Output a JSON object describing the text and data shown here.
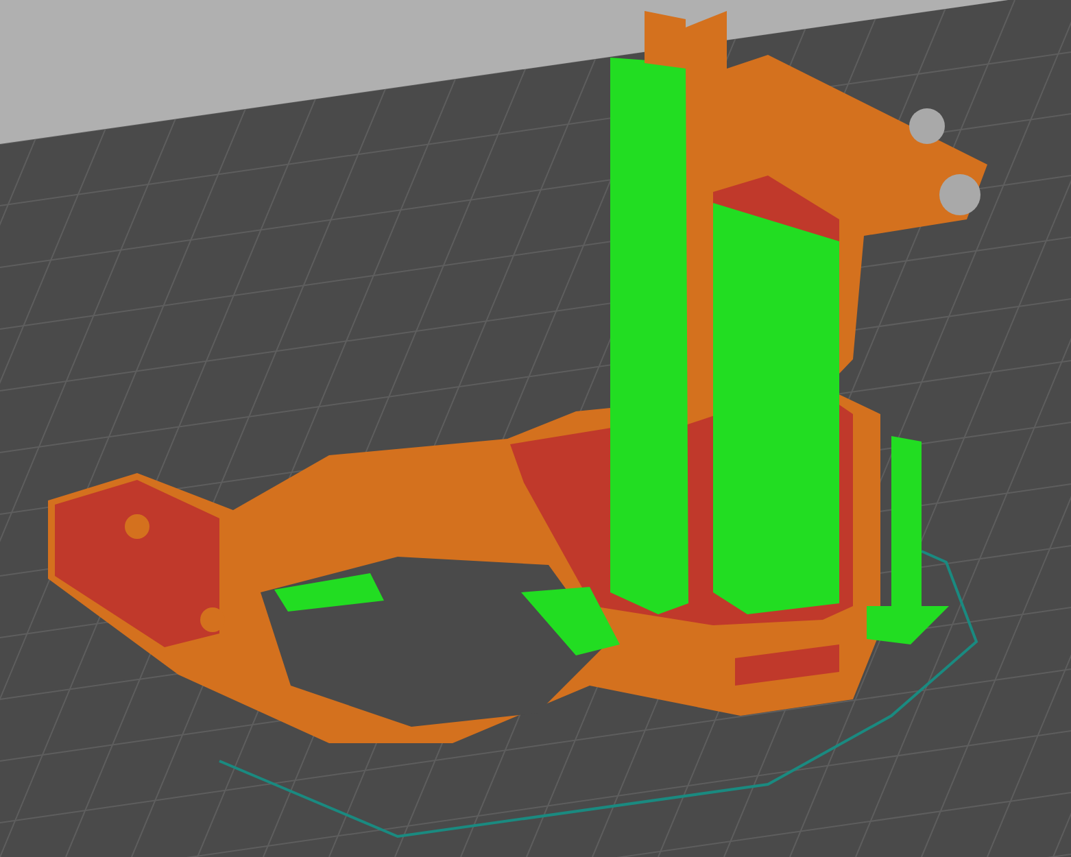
{
  "viewport": {
    "kind": "slicer-preview"
  }
}
